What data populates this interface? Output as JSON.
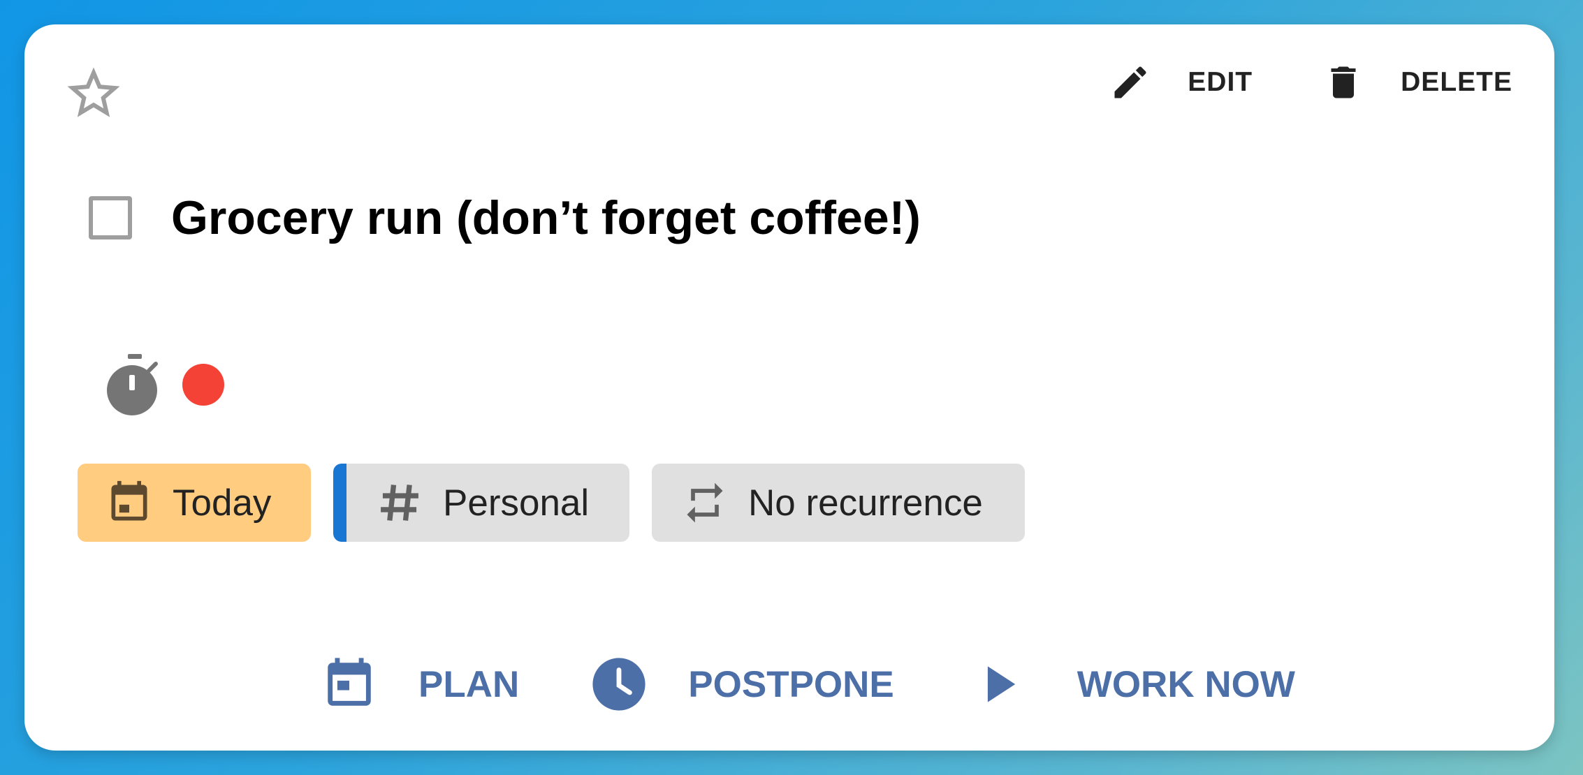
{
  "task": {
    "title": "Grocery run (don’t forget coffee!)",
    "completed": false,
    "starred": false,
    "priority_color": "#f44336"
  },
  "toolbar": {
    "edit_label": "EDIT",
    "delete_label": "DELETE"
  },
  "chips": {
    "date_label": "Today",
    "date_color": "#ffcc80",
    "project_label": "Personal",
    "project_color": "#1976d2",
    "recurrence_label": "No recurrence"
  },
  "actions": {
    "plan_label": "PLAN",
    "postpone_label": "POSTPONE",
    "work_now_label": "WORK NOW",
    "accent_color": "#4d6fa8"
  },
  "icons": {
    "star": "star-outline-icon",
    "edit": "pencil-icon",
    "delete": "trash-icon",
    "timer": "stopwatch-icon",
    "date": "calendar-icon",
    "project": "hashtag-icon",
    "recurrence": "repeat-icon",
    "plan": "calendar-icon",
    "postpone": "clock-icon",
    "work_now": "play-icon"
  }
}
